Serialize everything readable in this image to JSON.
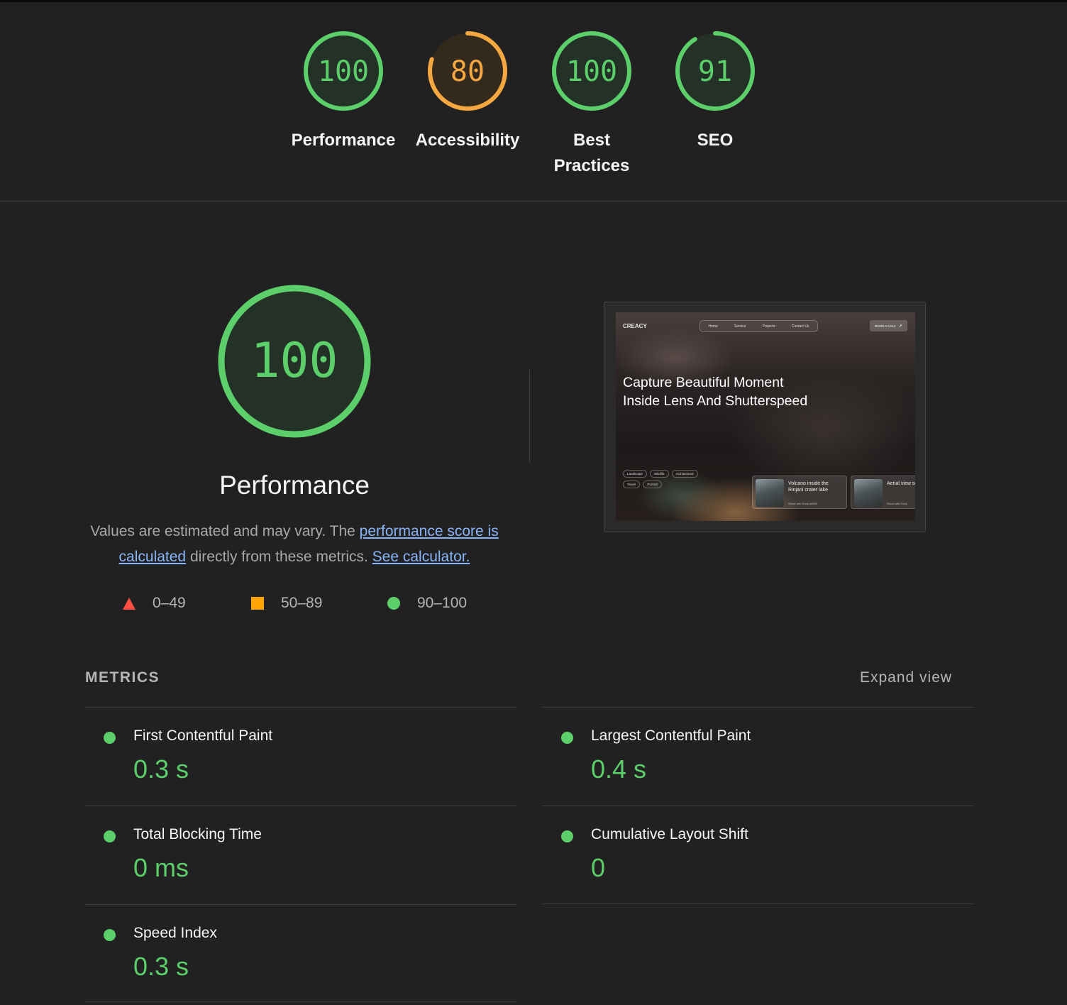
{
  "colors": {
    "pass": "#5ccf6b",
    "average": "#f5a742",
    "fail": "#ff4e42",
    "background": "#212121",
    "link": "#8ab4f8"
  },
  "gauges": [
    {
      "score": "100",
      "value": 100,
      "label": "Performance",
      "status": "pass"
    },
    {
      "score": "80",
      "value": 80,
      "label": "Accessibility",
      "status": "average"
    },
    {
      "score": "100",
      "value": 100,
      "label": "Best Practices",
      "status": "pass"
    },
    {
      "score": "91",
      "value": 91,
      "label": "SEO",
      "status": "pass"
    }
  ],
  "performance": {
    "score": "100",
    "value": 100,
    "title": "Performance",
    "desc_prefix": "Values are estimated and may vary. The ",
    "link_score": "performance score is calculated",
    "desc_middle": " directly from these metrics. ",
    "link_calculator": "See calculator.",
    "legend": {
      "fail": "0–49",
      "average": "50–89",
      "pass": "90–100"
    }
  },
  "thumbnail": {
    "logo": "CREACY",
    "nav": [
      "Home",
      "Service",
      "Projects",
      "Contact Us"
    ],
    "cta": "BOOK A CALL",
    "hero": "Capture Beautiful Moment Inside Lens And Shutterspeed",
    "tags": [
      "Landscape",
      "Wildlife",
      "Architectural",
      "Travel",
      "Portrait"
    ],
    "cards": [
      {
        "caption": "Volcano inside the Rinjani crater lake",
        "meta": "Shoot with Sony a6000"
      },
      {
        "caption": "Aerial view sembalun",
        "meta": "Shoot with Sony"
      }
    ]
  },
  "metrics": {
    "title": "METRICS",
    "expand_label": "Expand view",
    "items": [
      {
        "name": "First Contentful Paint",
        "value": "0.3 s"
      },
      {
        "name": "Largest Contentful Paint",
        "value": "0.4 s"
      },
      {
        "name": "Total Blocking Time",
        "value": "0 ms"
      },
      {
        "name": "Cumulative Layout Shift",
        "value": "0"
      },
      {
        "name": "Speed Index",
        "value": "0.3 s"
      }
    ]
  }
}
